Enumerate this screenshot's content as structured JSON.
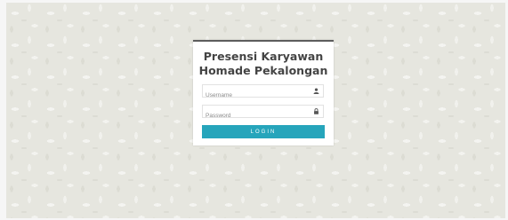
{
  "login": {
    "title_line1": "Presensi Karyawan",
    "title_line2": "Homade Pekalongan",
    "username_placeholder": "Username",
    "password_placeholder": "Password",
    "button_label": "LOGIN",
    "username_icon": "user-icon",
    "password_icon": "lock-icon"
  },
  "colors": {
    "accent": "#26a5bb",
    "card_top_border": "#5d5d5d",
    "background_pattern": "#e6e6df"
  }
}
